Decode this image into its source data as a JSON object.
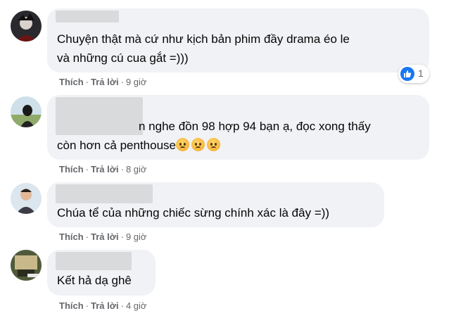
{
  "comments": [
    {
      "text_lines": [
        "Chuyện thật mà cứ như kịch bản phim đầy drama éo le",
        "và những cú cua gắt =)))"
      ],
      "actions": {
        "like": "Thích",
        "reply": "Trả lời",
        "time": "9 giờ"
      },
      "reaction": {
        "icon": "like-icon",
        "count": "1",
        "color": "#1877f2"
      }
    },
    {
      "text_lines": [
        "n nghe đồn 98 hợp 94 bạn ạ, đọc xong thấy",
        "còn hơn cả penthouse"
      ],
      "emojis": [
        "worried-face-icon",
        "worried-face-icon",
        "worried-face-icon"
      ],
      "actions": {
        "like": "Thích",
        "reply": "Trả lời",
        "time": "8 giờ"
      }
    },
    {
      "text_lines": [
        "Chúa tể của những chiếc sừng chính xác là đây =))"
      ],
      "actions": {
        "like": "Thích",
        "reply": "Trả lời",
        "time": "9 giờ"
      }
    },
    {
      "text_lines": [
        "Kết hả dạ ghê"
      ],
      "actions": {
        "like": "Thích",
        "reply": "Trả lời",
        "time": "4 giờ"
      }
    }
  ],
  "colors": {
    "bubble": "#f0f2f5",
    "action_text": "#65676b",
    "like_blue": "#1877f2"
  }
}
